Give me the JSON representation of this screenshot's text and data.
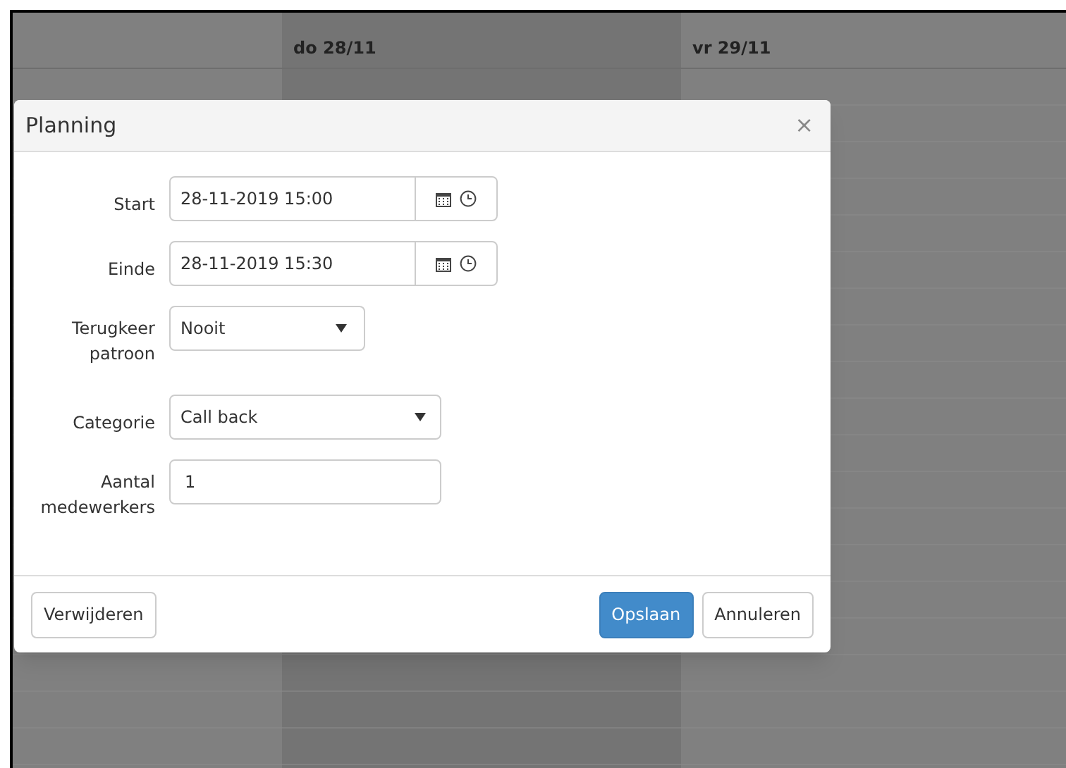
{
  "calendar": {
    "columns": [
      {
        "selected": false
      },
      {
        "header": "do 28/11",
        "selected": true
      },
      {
        "header": "vr 29/11",
        "selected": false
      }
    ]
  },
  "dialog": {
    "title": "Planning",
    "close": "×",
    "fields": [
      {
        "kind": "datetime",
        "label": "Start",
        "value": "28-11-2019 15:00"
      },
      {
        "kind": "datetime",
        "label": "Einde",
        "value": "28-11-2019 15:30"
      },
      {
        "kind": "select",
        "label": "Terugkeer patroon",
        "value": "Nooit"
      },
      {
        "kind": "select",
        "label": "Categorie",
        "value": "Call back"
      },
      {
        "kind": "text",
        "label": "Aantal medewerkers",
        "value": "1"
      }
    ],
    "buttons": [
      {
        "label": "Verwijderen",
        "kind": "default"
      },
      {
        "label": "Opslaan",
        "kind": "primary"
      },
      {
        "label": "Annuleren",
        "kind": "default"
      }
    ]
  }
}
